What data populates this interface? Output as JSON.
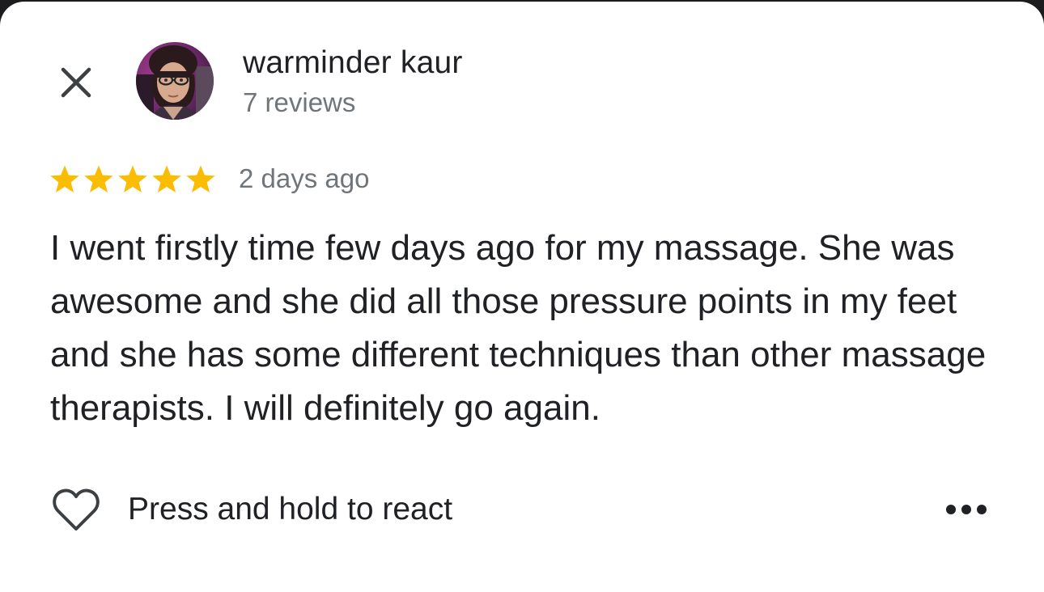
{
  "header": {
    "close_icon": "close-icon",
    "author_name": "warminder kaur",
    "review_count": "7 reviews"
  },
  "review": {
    "rating": 5,
    "rating_max": 5,
    "star_color": "#fbbc04",
    "date": "2 days ago",
    "text": "I went firstly time few days ago for my massage. She was awesome and she did all those pressure points in my feet and she has some different techniques than other massage therapists. I will definitely go again."
  },
  "actions": {
    "heart_icon": "heart-outline-icon",
    "react_label": "Press and hold to react",
    "more_icon": "more-horizontal-icon"
  }
}
